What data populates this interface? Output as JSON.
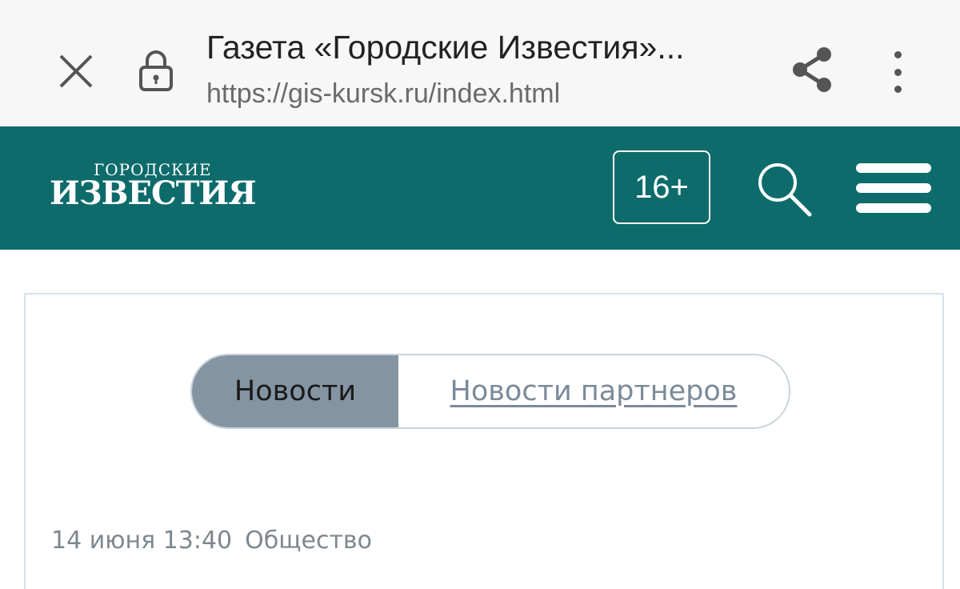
{
  "browser": {
    "title": "Газета «Городские Известия»...",
    "url": "https://gis-kursk.ru/index.html",
    "icons": {
      "close": "close-icon",
      "lock": "lock-icon",
      "share": "share-icon",
      "more": "more-vertical-icon"
    }
  },
  "header": {
    "logo_top": "ГОРОДСКИЕ",
    "logo_main": "ИЗВЕСТИЯ",
    "age_rating": "16+",
    "icons": {
      "search": "search-icon",
      "menu": "hamburger-menu-icon"
    },
    "bg_color": "#0e6b6b"
  },
  "content": {
    "tabs": [
      {
        "label": "Новости",
        "active": true
      },
      {
        "label": "Новости партнеров",
        "active": false
      }
    ],
    "article_meta": {
      "date": "14 июня 13:40",
      "category": "Общество"
    }
  }
}
